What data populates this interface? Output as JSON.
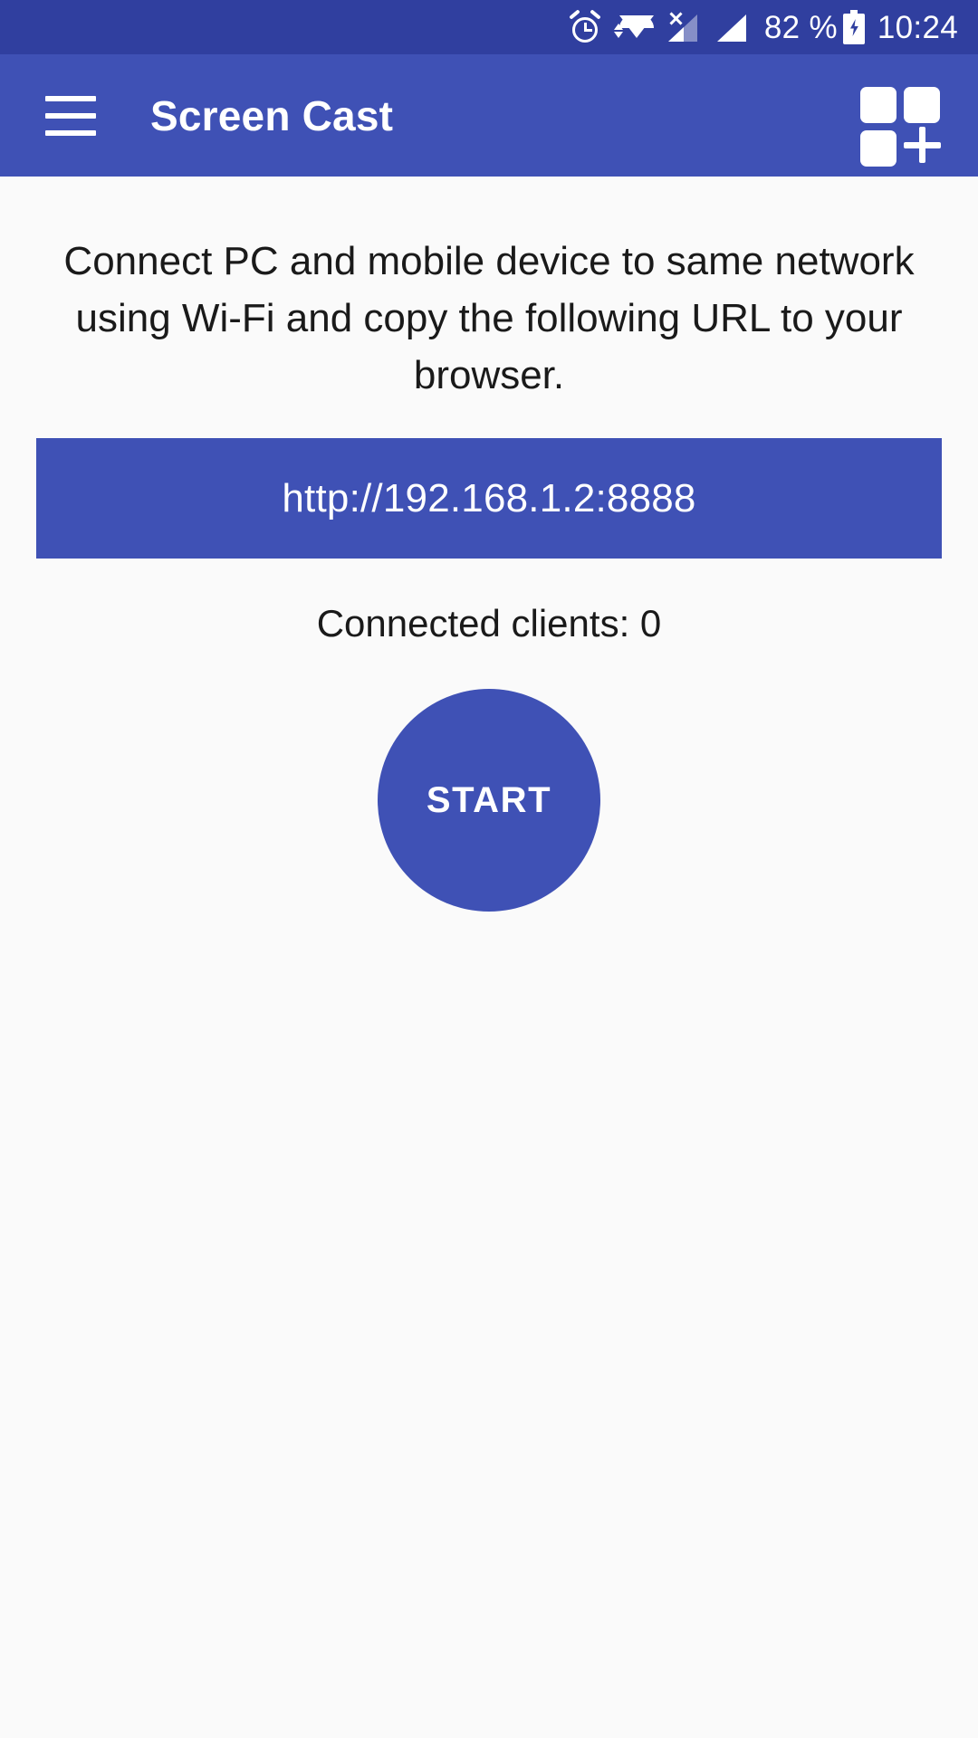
{
  "status_bar": {
    "background_color": "#303f9f",
    "icons": [
      {
        "name": "alarm-icon"
      },
      {
        "name": "wifi-icon"
      },
      {
        "name": "signal-no-service-icon"
      },
      {
        "name": "signal-full-icon"
      }
    ],
    "battery_percent": "82 %",
    "battery_icon": "battery-charging-icon",
    "time": "10:24"
  },
  "app_bar": {
    "background_color": "#3f51b5",
    "menu_icon": "hamburger-menu-icon",
    "title": "Screen Cast",
    "action_icon": "add-cast-device-icon"
  },
  "main": {
    "instruction": "Connect PC and mobile device to same network using Wi-Fi and copy the following URL to your browser.",
    "url": "http://192.168.1.2:8888",
    "url_banner_color": "#3f51b5",
    "connected_clients_label": "Connected clients: 0",
    "start_button_label": "START",
    "start_button_color": "#3f51b5",
    "background_color": "#fafafa"
  }
}
